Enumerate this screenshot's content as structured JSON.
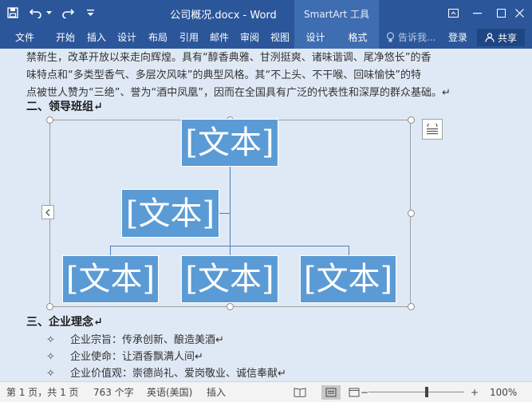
{
  "titlebar": {
    "doc_title": "公司概况.docx - Word",
    "context_header": "SmartArt 工具"
  },
  "ribbon": {
    "tabs": [
      "文件",
      "开始",
      "插入",
      "设计",
      "布局",
      "引用",
      "邮件",
      "审阅",
      "视图",
      "设计",
      "格式"
    ],
    "tell_me": "告诉我...",
    "login": "登录",
    "share": "共享"
  },
  "document": {
    "para_lines": [
      "禁新生，改革开放以来走向辉煌。具有“醇香典雅、甘洌挺爽、诸味谐调、尾净悠长”的香",
      "味特点和“多类型香气、多层次风味”的典型风格。其“不上头、不干喉、回味愉快”的特",
      "点被世人赞为“三绝”、誉为“酒中凤凰”，因而在全国具有广泛的代表性和深厚的群众基础。↵"
    ],
    "heading2": "二、领导班组↵",
    "smartart_nodes": [
      "[文本]",
      "[文本]",
      "[文本]",
      "[文本]",
      "[文本]"
    ],
    "heading3": "三、企业理念↵",
    "bullets": [
      "企业宗旨：传承创新、酿造美酒↵",
      "企业使命：让酒香飘满人间↵",
      "企业价值观：崇德尚礼、爱岗敬业、诚信奉献↵"
    ]
  },
  "status": {
    "page": "第 1 页，共 1 页",
    "words": "763 个字",
    "language": "英语(美国)",
    "mode": "插入",
    "zoom": "100%",
    "zoom_minus": "−",
    "zoom_plus": "+"
  }
}
